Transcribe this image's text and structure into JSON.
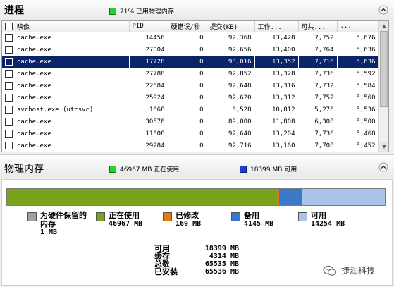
{
  "processes": {
    "title": "进程",
    "usage_text": "71% 已用物理内存",
    "columns": [
      "映像",
      "PID",
      "硬错误/秒",
      "提交(KB)",
      "工作...",
      "可共...",
      "..."
    ],
    "rows": [
      {
        "image": "cache.exe",
        "pid": "14456",
        "hard_faults": "0",
        "commit": "92,368",
        "working": "13,428",
        "shareable": "7,752",
        "private": "5,676",
        "selected": false
      },
      {
        "image": "cache.exe",
        "pid": "27004",
        "hard_faults": "0",
        "commit": "92,656",
        "working": "13,400",
        "shareable": "7,764",
        "private": "5,636",
        "selected": false
      },
      {
        "image": "cache.exe",
        "pid": "17728",
        "hard_faults": "0",
        "commit": "93,016",
        "working": "13,352",
        "shareable": "7,716",
        "private": "5,636",
        "selected": true
      },
      {
        "image": "cache.exe",
        "pid": "27788",
        "hard_faults": "0",
        "commit": "92,852",
        "working": "13,328",
        "shareable": "7,736",
        "private": "5,592",
        "selected": false
      },
      {
        "image": "cache.exe",
        "pid": "22684",
        "hard_faults": "0",
        "commit": "92,648",
        "working": "13,316",
        "shareable": "7,732",
        "private": "5,584",
        "selected": false
      },
      {
        "image": "cache.exe",
        "pid": "25924",
        "hard_faults": "0",
        "commit": "92,620",
        "working": "13,312",
        "shareable": "7,752",
        "private": "5,560",
        "selected": false
      },
      {
        "image": "svchost.exe (utcsvc)",
        "pid": "1668",
        "hard_faults": "0",
        "commit": "6,528",
        "working": "10,812",
        "shareable": "5,276",
        "private": "5,536",
        "selected": false
      },
      {
        "image": "cache.exe",
        "pid": "30576",
        "hard_faults": "0",
        "commit": "89,000",
        "working": "11,808",
        "shareable": "6,308",
        "private": "5,500",
        "selected": false
      },
      {
        "image": "cache.exe",
        "pid": "11608",
        "hard_faults": "0",
        "commit": "92,640",
        "working": "13,204",
        "shareable": "7,736",
        "private": "5,468",
        "selected": false
      },
      {
        "image": "cache.exe",
        "pid": "29284",
        "hard_faults": "0",
        "commit": "92,716",
        "working": "13,160",
        "shareable": "7,708",
        "private": "5,452",
        "selected": false
      }
    ]
  },
  "memory": {
    "title": "物理内存",
    "in_use_text": "46967 MB 正在使用",
    "available_text": "18399 MB 可用",
    "bar": [
      {
        "name": "reserved",
        "value": 1,
        "color": "#ffffff"
      },
      {
        "name": "in_use",
        "value": 46967,
        "color": "#7aa21b"
      },
      {
        "name": "modified",
        "value": 169,
        "color": "#e07a14"
      },
      {
        "name": "standby",
        "value": 4145,
        "color": "#3c78c8"
      },
      {
        "name": "free",
        "value": 14254,
        "color": "#a9c4e6"
      }
    ],
    "legend": [
      {
        "label": "为硬件保留的内存",
        "value": "1 MB",
        "color": "#a0a0a0"
      },
      {
        "label": "正在使用",
        "value": "46967 MB",
        "color": "#7aa21b"
      },
      {
        "label": "已修改",
        "value": "169 MB",
        "color": "#e07a14"
      },
      {
        "label": "备用",
        "value": "4145 MB",
        "color": "#3c78c8"
      },
      {
        "label": "可用",
        "value": "14254 MB",
        "color": "#a9c4e6"
      }
    ],
    "summary": [
      {
        "label": "可用",
        "value": "18399 MB"
      },
      {
        "label": "缓存",
        "value": "4314 MB"
      },
      {
        "label": "总数",
        "value": "65535 MB"
      },
      {
        "label": "已安装",
        "value": "65536 MB"
      }
    ]
  },
  "watermark": "捷润科技"
}
